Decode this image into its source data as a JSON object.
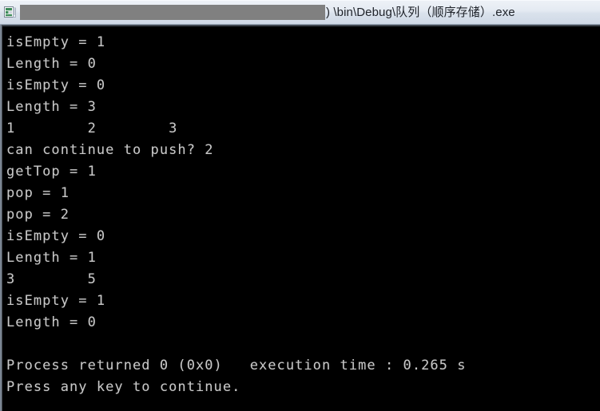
{
  "window": {
    "title_icon": "console-app-icon",
    "title_redacted_block": "",
    "title_text": ") \\bin\\Debug\\队列（顺序存储）.exe",
    "background_color": "#000000",
    "text_color": "#c8c8c8",
    "titlebar_color": "#dfe6ef"
  },
  "console": {
    "lines": [
      "isEmpty = 1",
      "Length = 0",
      "isEmpty = 0",
      "Length = 3",
      "1        2        3",
      "can continue to push? 2",
      "getTop = 1",
      "pop = 1",
      "pop = 2",
      "isEmpty = 0",
      "Length = 1",
      "3        5",
      "isEmpty = 1",
      "Length = 0",
      "",
      "Process returned 0 (0x0)   execution time : 0.265 s",
      "Press any key to continue."
    ],
    "full_text": "isEmpty = 1\nLength = 0\nisEmpty = 0\nLength = 3\n1        2        3\ncan continue to push? 2\ngetTop = 1\npop = 1\npop = 2\nisEmpty = 0\nLength = 1\n3        5\nisEmpty = 1\nLength = 0\n\nProcess returned 0 (0x0)   execution time : 0.265 s\nPress any key to continue.",
    "exit_code": "0",
    "exit_code_hex": "0x0",
    "execution_time": "0.265 s",
    "prompt": "Press any key to continue."
  }
}
